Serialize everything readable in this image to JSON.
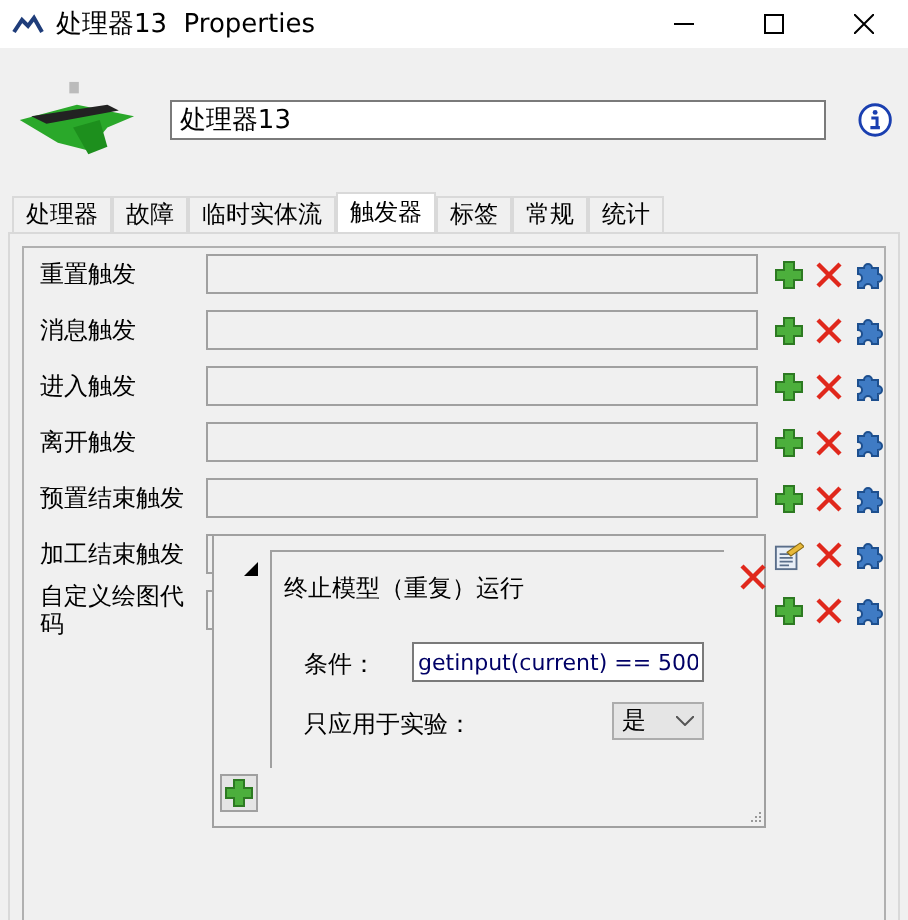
{
  "window": {
    "title": "处理器13  Properties"
  },
  "object_name": {
    "value": "处理器13"
  },
  "tabs": [
    {
      "label": "处理器",
      "selected": false
    },
    {
      "label": "故障",
      "selected": false
    },
    {
      "label": "临时实体流",
      "selected": false
    },
    {
      "label": "触发器",
      "selected": true
    },
    {
      "label": "标签",
      "selected": false
    },
    {
      "label": "常规",
      "selected": false
    },
    {
      "label": "统计",
      "selected": false
    }
  ],
  "triggers": [
    {
      "label": "重置触发",
      "kind": "add"
    },
    {
      "label": "消息触发",
      "kind": "add"
    },
    {
      "label": "进入触发",
      "kind": "add"
    },
    {
      "label": "离开触发",
      "kind": "add"
    },
    {
      "label": "预置结束触发",
      "kind": "add"
    },
    {
      "label": "加工结束触发",
      "kind": "edit"
    },
    {
      "label": "自定义绘图代码",
      "kind": "add"
    }
  ],
  "popup": {
    "expanded": true,
    "title": "终止模型（重复）运行",
    "condition": {
      "label": "条件：",
      "value": "getinput(current) == 500"
    },
    "option": {
      "label": "只应用于实验：",
      "value": "是"
    }
  }
}
